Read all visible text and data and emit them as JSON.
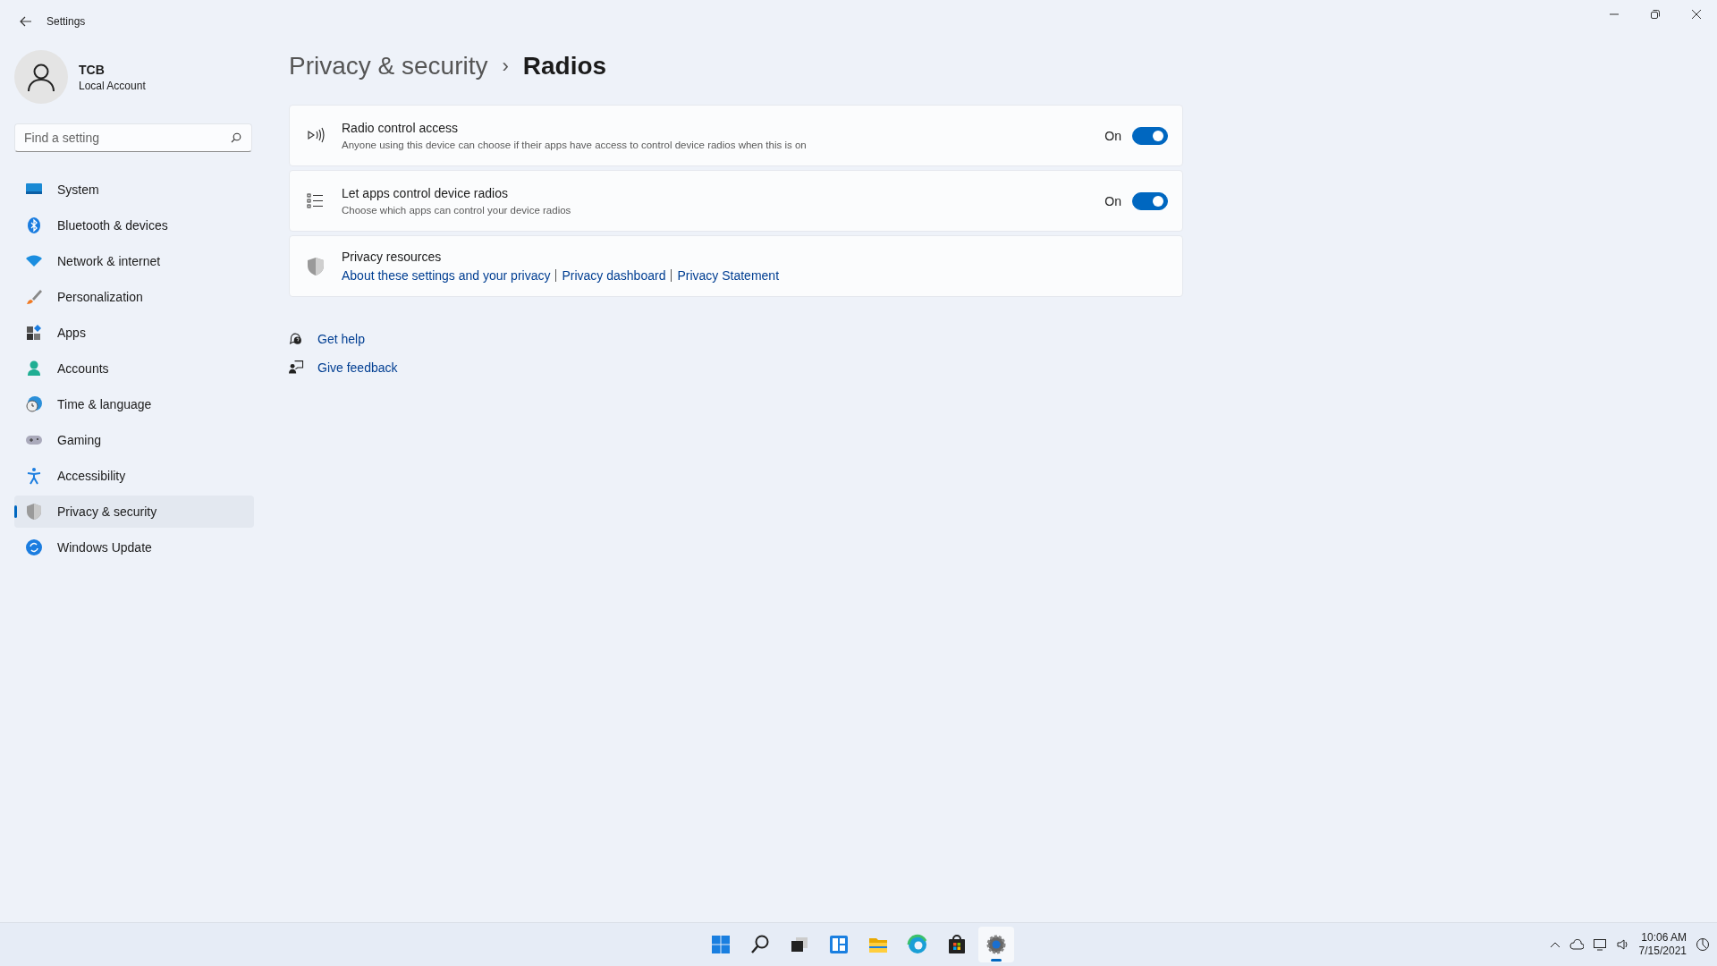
{
  "window": {
    "title": "Settings"
  },
  "account": {
    "name": "TCB",
    "type": "Local Account"
  },
  "search": {
    "placeholder": "Find a setting"
  },
  "nav": [
    {
      "label": "System",
      "selected": false
    },
    {
      "label": "Bluetooth & devices",
      "selected": false
    },
    {
      "label": "Network & internet",
      "selected": false
    },
    {
      "label": "Personalization",
      "selected": false
    },
    {
      "label": "Apps",
      "selected": false
    },
    {
      "label": "Accounts",
      "selected": false
    },
    {
      "label": "Time & language",
      "selected": false
    },
    {
      "label": "Gaming",
      "selected": false
    },
    {
      "label": "Accessibility",
      "selected": false
    },
    {
      "label": "Privacy & security",
      "selected": true
    },
    {
      "label": "Windows Update",
      "selected": false
    }
  ],
  "breadcrumb": {
    "parent": "Privacy & security",
    "separator": "›",
    "current": "Radios"
  },
  "settings": [
    {
      "title": "Radio control access",
      "description": "Anyone using this device can choose if their apps have access to control device radios when this is on",
      "state_label": "On",
      "on": true
    },
    {
      "title": "Let apps control device radios",
      "description": "Choose which apps can control your device radios",
      "state_label": "On",
      "on": true
    }
  ],
  "resources": {
    "title": "Privacy resources",
    "links": [
      "About these settings and your privacy",
      "Privacy dashboard",
      "Privacy Statement"
    ]
  },
  "help_links": [
    "Get help",
    "Give feedback"
  ],
  "taskbar": {
    "apps": [
      {
        "selected": false
      },
      {
        "selected": false
      },
      {
        "selected": false
      },
      {
        "selected": false
      },
      {
        "selected": false
      },
      {
        "selected": false
      },
      {
        "selected": false
      },
      {
        "selected": true
      }
    ],
    "time": "10:06 AM",
    "date": "7/15/2021"
  }
}
